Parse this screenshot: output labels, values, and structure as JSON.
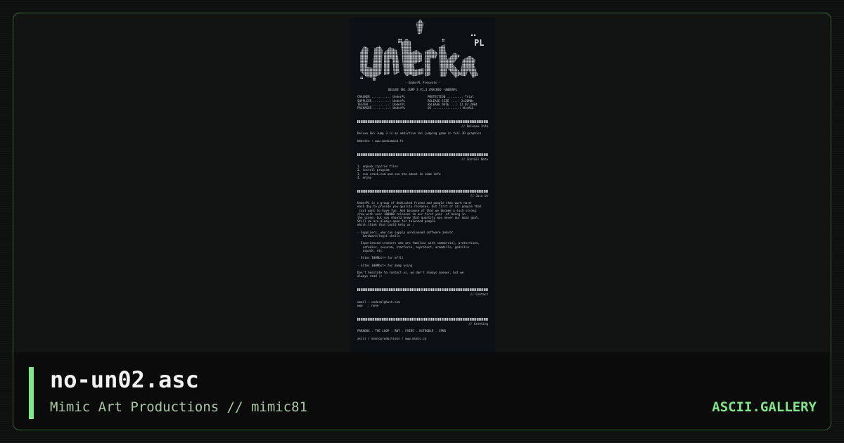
{
  "artwork": {
    "logo_tag": "PL",
    "crew_line": "- UnderPL Presents -",
    "release_line": "DELUXE SKi JUMP 3 V1.3 CRACKED -UNDERPL",
    "specs_left": [
      "CRACKER ..........: UnderPL",
      "SUPPLIER .........: UnderPL",
      "TESTER ...........: UnderPL",
      "PACKAGER .........: UnderPL"
    ],
    "specs_right": [
      "PROTECTION ........: Trial",
      "RELEASE SIZE ....: 2x20MBs",
      "RELEASE DATE ...: 12.07.2004",
      "OS ...............: WinALL"
    ],
    "sections": [
      {
        "header": "// Release Info",
        "lines": [
          "Deluxe Ski Jump 3 is an addictive ski jumping game in full 3D graphics",
          "",
          "Website : www.mediamond.fi"
        ]
      },
      {
        "header": "// Install Note",
        "lines": [
          "1. unpack zip/rar files",
          "2. install program",
          "3. run crack.com and see the about in some info",
          "4. enjoy"
        ]
      },
      {
        "header": "// Join Us",
        "lines": [
          "UnderPL is a group of dedicated friend and people that work hard",
          "each day to provide you quality releases, but first of all people that",
          " just want to have fun. And because of that we become a such strong",
          "crew with over 100000 releases in our first year  of being in",
          "the scene, but you should know that quantity was never our main goal.",
          "Still we are always open for talented people",
          "which think that could help us :",
          "",
          "- Suppliers, who can supply unreleased software and/or",
          "   hardware/legit shells",
          "",
          "- Experienced crackers who are familiar with commercial, protections,",
          "   safedisc, securom, starforce, asprotect, armadillo, godzilla",
          "   aspack, etc.",
          "",
          "- Sites 100Mbit+ for affil",
          "",
          "- Sites 100Mbit+ for dump using",
          "",
          "Don't hesitate to contact us, we don't always answer, but we",
          "always read :)"
        ]
      },
      {
        "header": "// Contact",
        "lines": [
          "email : underpl@hush.com",
          "www   : none"
        ]
      },
      {
        "header": "// Greeting",
        "lines": [
          "PARADOX . THE LOOP . RNT . FAIRS . NiTRODiS . CPNG",
          "",
          "ascii / mimicproductions / www.mimic.ca"
        ]
      }
    ]
  },
  "footer": {
    "title": "no-un02.asc",
    "subtitle": "Mimic Art Productions // mimic81",
    "brand": "ASCII.GALLERY"
  },
  "colors": {
    "accent": "#7ee787",
    "frame_border": "#2f6b32",
    "art_background": "#0b1014",
    "art_text": "#c7ccd0"
  }
}
